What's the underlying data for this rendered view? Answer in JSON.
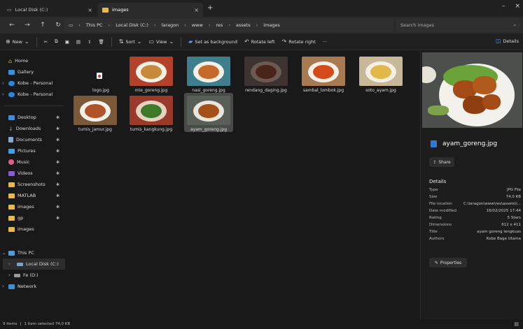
{
  "tabs": [
    {
      "label": "Local Disk (C:)",
      "icon": "drive-icon"
    },
    {
      "label": "images",
      "icon": "folder-icon"
    }
  ],
  "address": {
    "segments": [
      "This PC",
      "Local Disk (C:)",
      "laragon",
      "www",
      "res",
      "assets",
      "images"
    ]
  },
  "search": {
    "placeholder": "Search images"
  },
  "toolbar": {
    "new_label": "New",
    "sort_label": "Sort",
    "view_label": "View",
    "set_bg_label": "Set as background",
    "rotate_left_label": "Rotate left",
    "rotate_right_label": "Rotate right",
    "more_label": "···",
    "details_label": "Details"
  },
  "sidebar": {
    "items": [
      {
        "label": "Home"
      },
      {
        "label": "Gallery"
      },
      {
        "label": "Kobe - Personal"
      },
      {
        "label": "Kobe - Personal"
      },
      {
        "label": "Desktop"
      },
      {
        "label": "Downloads"
      },
      {
        "label": "Documents"
      },
      {
        "label": "Pictures"
      },
      {
        "label": "Music"
      },
      {
        "label": "Videos"
      },
      {
        "label": "Screenshots"
      },
      {
        "label": "MATLAB"
      },
      {
        "label": "images"
      },
      {
        "label": "gp"
      },
      {
        "label": "images"
      },
      {
        "label": "This PC"
      },
      {
        "label": "Local Disk (C:)"
      },
      {
        "label": "Fe (D:)"
      },
      {
        "label": "Network"
      }
    ]
  },
  "files": [
    {
      "name": "logo.jpg"
    },
    {
      "name": "mie_goreng.jpg"
    },
    {
      "name": "nasi_goreng.jpg"
    },
    {
      "name": "rendang_daging.jpg"
    },
    {
      "name": "sambal_lombok.jpg"
    },
    {
      "name": "soto_ayam.jpg"
    },
    {
      "name": "tumis_jamur.jpg"
    },
    {
      "name": "tumis_kangkung.jpg"
    },
    {
      "name": "ayam_goreng.jpg"
    }
  ],
  "preview": {
    "filename": "ayam_goreng.jpg",
    "share_label": "Share",
    "details_heading": "Details",
    "properties_label": "Properties",
    "details": [
      {
        "key": "Type",
        "value": "JPG File"
      },
      {
        "key": "Size",
        "value": "74,0 KB"
      },
      {
        "key": "File location",
        "value": "C:\\laragon\\www\\res\\assets\\i..."
      },
      {
        "key": "Date modified",
        "value": "16/02/2025 17:44"
      },
      {
        "key": "Rating",
        "value": "5 Stars"
      },
      {
        "key": "Dimensions",
        "value": "612 x 411"
      },
      {
        "key": "Title",
        "value": "ayam goreng lengkuas"
      },
      {
        "key": "Authors",
        "value": "Kobe Bage Utama"
      }
    ]
  },
  "status": {
    "items_count": "9 items",
    "selection": "1 item selected  74,0 KB"
  },
  "colors": {
    "accent": "#4aa3f0",
    "background": "#191919",
    "selected_tile": "#4a4a4a"
  }
}
